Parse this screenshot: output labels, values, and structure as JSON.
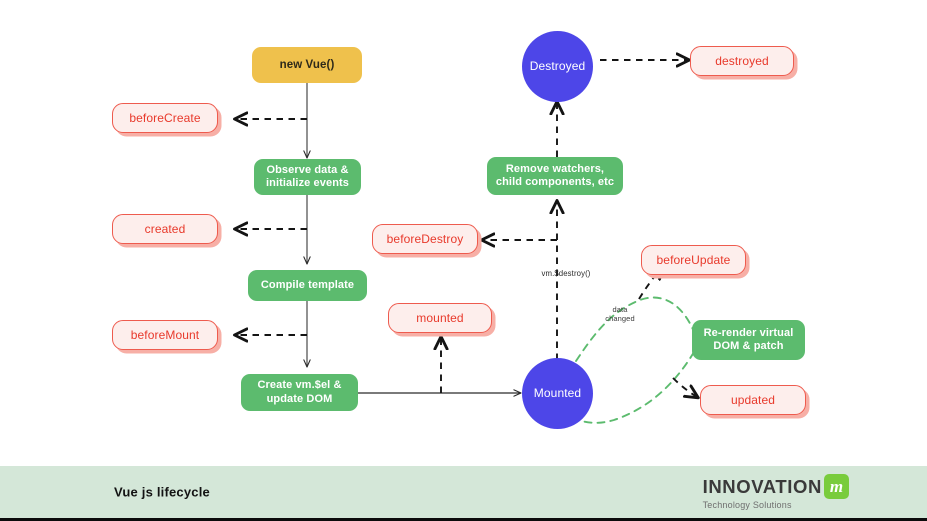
{
  "diagram": {
    "title": "Vue js lifecycle",
    "colors": {
      "start": "#EFC14C",
      "process": "#5CBB6E",
      "hook_fill": "#FDEEEC",
      "hook_border": "#EE5B4E",
      "hook_text": "#E8392B",
      "hook_shadow": "#F7AFA6",
      "state": "#4D46E8",
      "solid_edge": "#2b2b2b",
      "dashed_edge": "#141414",
      "data_edge": "#5CBB6E",
      "footer_bg": "#D4E7D8",
      "logo_mark": "#79CC3C"
    },
    "nodes": [
      {
        "id": "new-vue",
        "kind": "start",
        "label": "new Vue()"
      },
      {
        "id": "before-create",
        "kind": "hook",
        "label": "beforeCreate"
      },
      {
        "id": "observe-data",
        "kind": "process",
        "label": "Observe data &\ninitialize events"
      },
      {
        "id": "created",
        "kind": "hook",
        "label": "created"
      },
      {
        "id": "compile-template",
        "kind": "process",
        "label": "Compile template"
      },
      {
        "id": "before-mount",
        "kind": "hook",
        "label": "beforeMount"
      },
      {
        "id": "create-vm-el",
        "kind": "process",
        "label": "Create vm.$el &\nupdate DOM"
      },
      {
        "id": "mounted-hook",
        "kind": "hook",
        "label": "mounted"
      },
      {
        "id": "mounted-state",
        "kind": "state",
        "label": "Mounted"
      },
      {
        "id": "before-update",
        "kind": "hook",
        "label": "beforeUpdate"
      },
      {
        "id": "re-render",
        "kind": "process",
        "label": "Re-render virtual\nDOM & patch"
      },
      {
        "id": "updated",
        "kind": "hook",
        "label": "updated"
      },
      {
        "id": "before-destroy",
        "kind": "hook",
        "label": "beforeDestroy"
      },
      {
        "id": "remove-watchers",
        "kind": "process",
        "label": "Remove watchers,\nchild components, etc"
      },
      {
        "id": "destroyed-state",
        "kind": "state",
        "label": "Destroyed"
      },
      {
        "id": "destroyed-hook",
        "kind": "hook",
        "label": "destroyed"
      }
    ],
    "edge_labels": [
      {
        "id": "vm-destroy",
        "text": "vm.$destroy()"
      },
      {
        "id": "data-changed",
        "text": "data\nchanged"
      }
    ]
  },
  "footer": {
    "title": "Vue js lifecycle",
    "logo_word": "INNOVATION",
    "logo_mark": "m",
    "logo_sub": "Technology Solutions"
  }
}
